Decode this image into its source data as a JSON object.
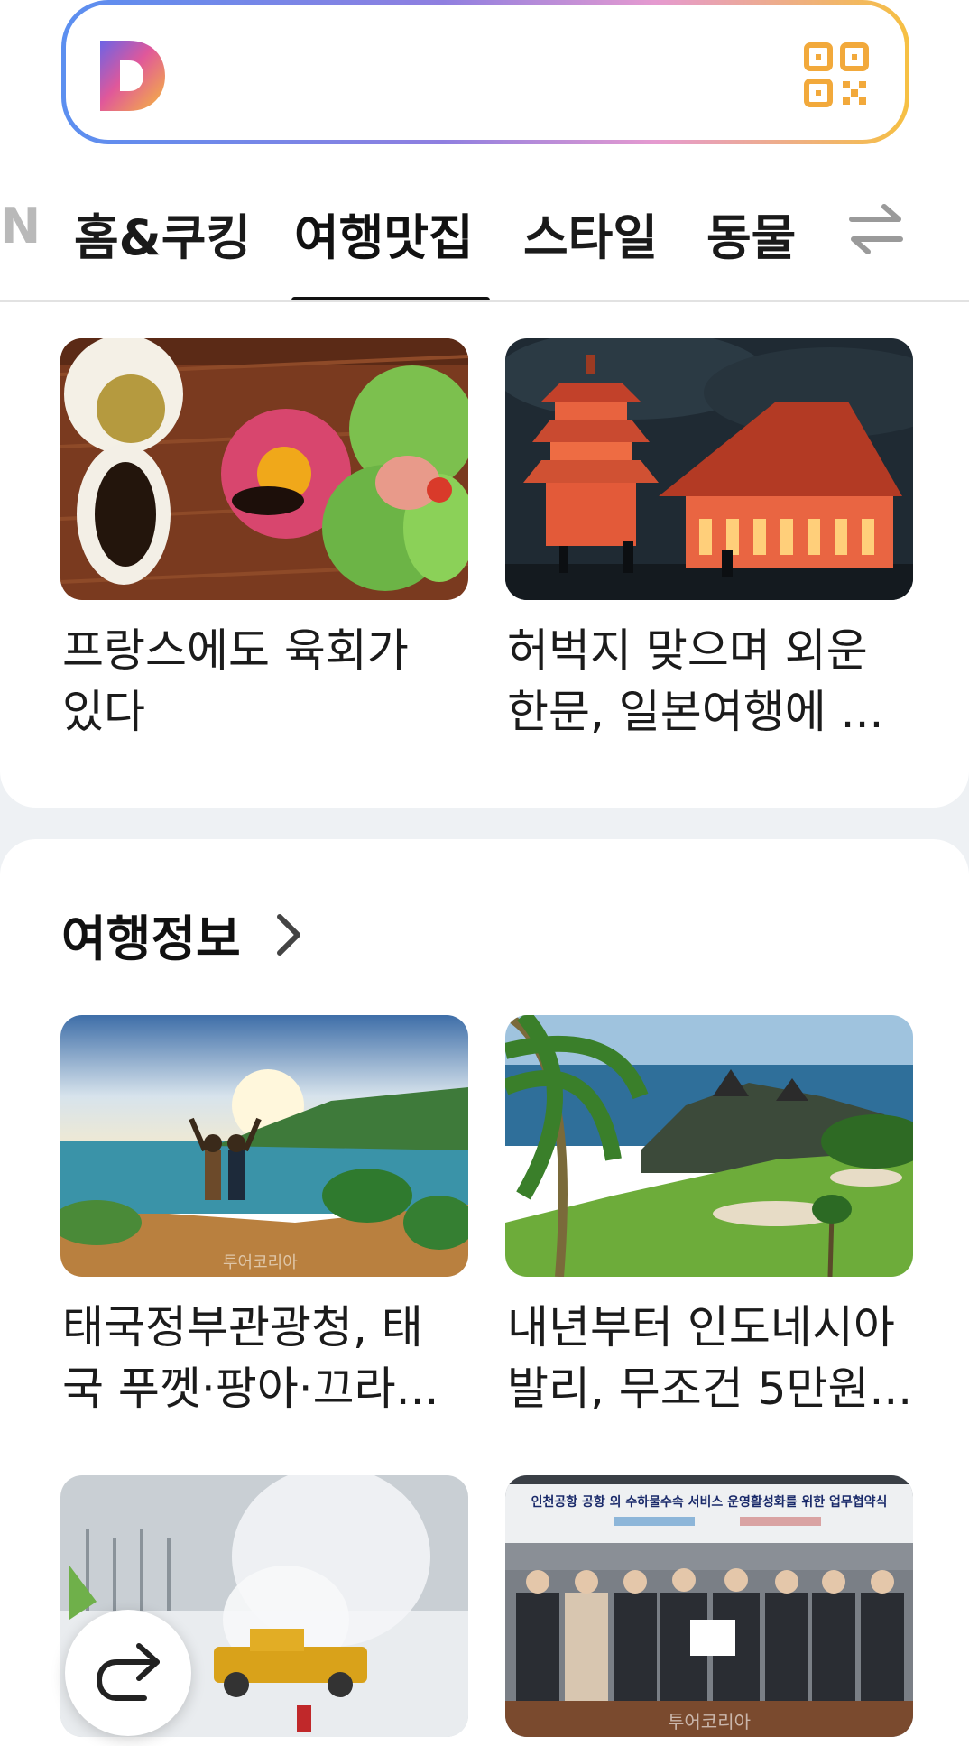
{
  "search": {
    "logo_letter": "D",
    "qr_icon": "qr-code-icon",
    "colors": {
      "grad_start": "#5b8ff0",
      "grad_mid": "#e59ad0",
      "grad_end": "#f6c042"
    }
  },
  "tabs": {
    "items": [
      {
        "label": "N",
        "state": "partial"
      },
      {
        "label": "홈&쿠킹",
        "state": "normal"
      },
      {
        "label": "여행맛집",
        "state": "active"
      },
      {
        "label": "스타일",
        "state": "normal"
      },
      {
        "label": "동물",
        "state": "normal"
      }
    ],
    "edit_icon": "swap-arrows-icon"
  },
  "feed_top": {
    "items": [
      {
        "caption": "프랑스에도 육회가\n있다",
        "image": "food-plate-photo"
      },
      {
        "caption": "허벅지 맞으며 외운\n한문, 일본여행에 ...",
        "image": "japanese-temple-photo"
      }
    ]
  },
  "travel_info": {
    "title": "여행정보",
    "chevron_icon": "chevron-right-icon",
    "items": [
      {
        "caption": "태국정부관광청, 태\n국 푸껫·팡아·끄라...",
        "image": "beach-couple-photo",
        "watermark": "투어코리아"
      },
      {
        "caption": "내년부터 인도네시아\n발리, 무조건 5만원...",
        "image": "bali-temple-golf-photo"
      },
      {
        "caption": "",
        "image": "airport-snow-photo"
      },
      {
        "caption": "",
        "image": "agreement-ceremony-photo",
        "banner": "인천공항 공항 외 수하물수속 서비스 운영활성화를 위한 업무협약식",
        "watermark": "투어코리아"
      }
    ]
  },
  "fab": {
    "icon": "share-redo-icon"
  }
}
